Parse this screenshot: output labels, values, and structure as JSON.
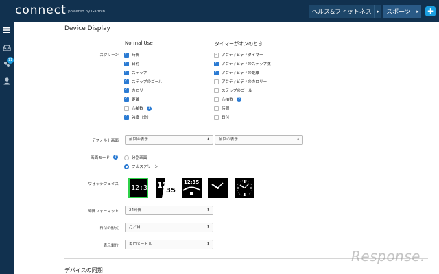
{
  "header": {
    "logo": "connect",
    "powered_by": "powered by Garmin",
    "nav": [
      {
        "label": "ヘルス&フィットネス",
        "arrow": "▸"
      },
      {
        "label": "スポーツ",
        "arrow": "▸"
      }
    ],
    "plus": "+"
  },
  "sidebar": {
    "badge": "11"
  },
  "device_display": {
    "title": "Device Display",
    "normal_use_header": "Normal Use",
    "timer_header": "タイマーがオンのとき",
    "screens_label": "スクリーン",
    "normal_items": [
      {
        "label": "時間",
        "checked": true
      },
      {
        "label": "日付",
        "checked": true
      },
      {
        "label": "ステップ",
        "checked": true
      },
      {
        "label": "ステップのゴール",
        "checked": true
      },
      {
        "label": "カロリー",
        "checked": true
      },
      {
        "label": "距離",
        "checked": true
      },
      {
        "label": "心拍数",
        "checked": false
      },
      {
        "label": "強度（分）",
        "checked": true
      }
    ],
    "timer_items": [
      {
        "label": "アクティビティタイマー",
        "checked": true
      },
      {
        "label": "アクティビティのステップ数",
        "checked": true
      },
      {
        "label": "アクティビティの距離",
        "checked": true
      },
      {
        "label": "アクティビティのカロリー",
        "checked": false
      },
      {
        "label": "ステップのゴール",
        "checked": false
      },
      {
        "label": "心拍数",
        "checked": false
      },
      {
        "label": "時間",
        "checked": false
      },
      {
        "label": "日付",
        "checked": false
      }
    ],
    "default_screen_label": "デフォルト画面",
    "default_screen_normal": "前回の表示",
    "default_screen_timer": "前回の表示",
    "screen_mode_label": "画面モード",
    "screen_mode_options": [
      {
        "label": "分割画面",
        "selected": false
      },
      {
        "label": "フルスクリーン",
        "selected": true
      }
    ],
    "watch_face_label": "ウォッチフェイス",
    "watch_faces": [
      {
        "time": "12:35"
      },
      {
        "hour": "12",
        "minute": "35"
      },
      {
        "time": "12:35"
      },
      {
        "kind": "analog"
      },
      {
        "kind": "analog-dial"
      }
    ],
    "time_format_label": "時間フォーマット",
    "time_format_value": "24時間",
    "date_format_label": "日付の形式",
    "date_format_value": "月／日",
    "units_label": "表示単位",
    "units_value": "キロメートル",
    "select_arrow": "⬍"
  },
  "device_sync": {
    "title": "デバイスの同期"
  },
  "watermark": "Response."
}
